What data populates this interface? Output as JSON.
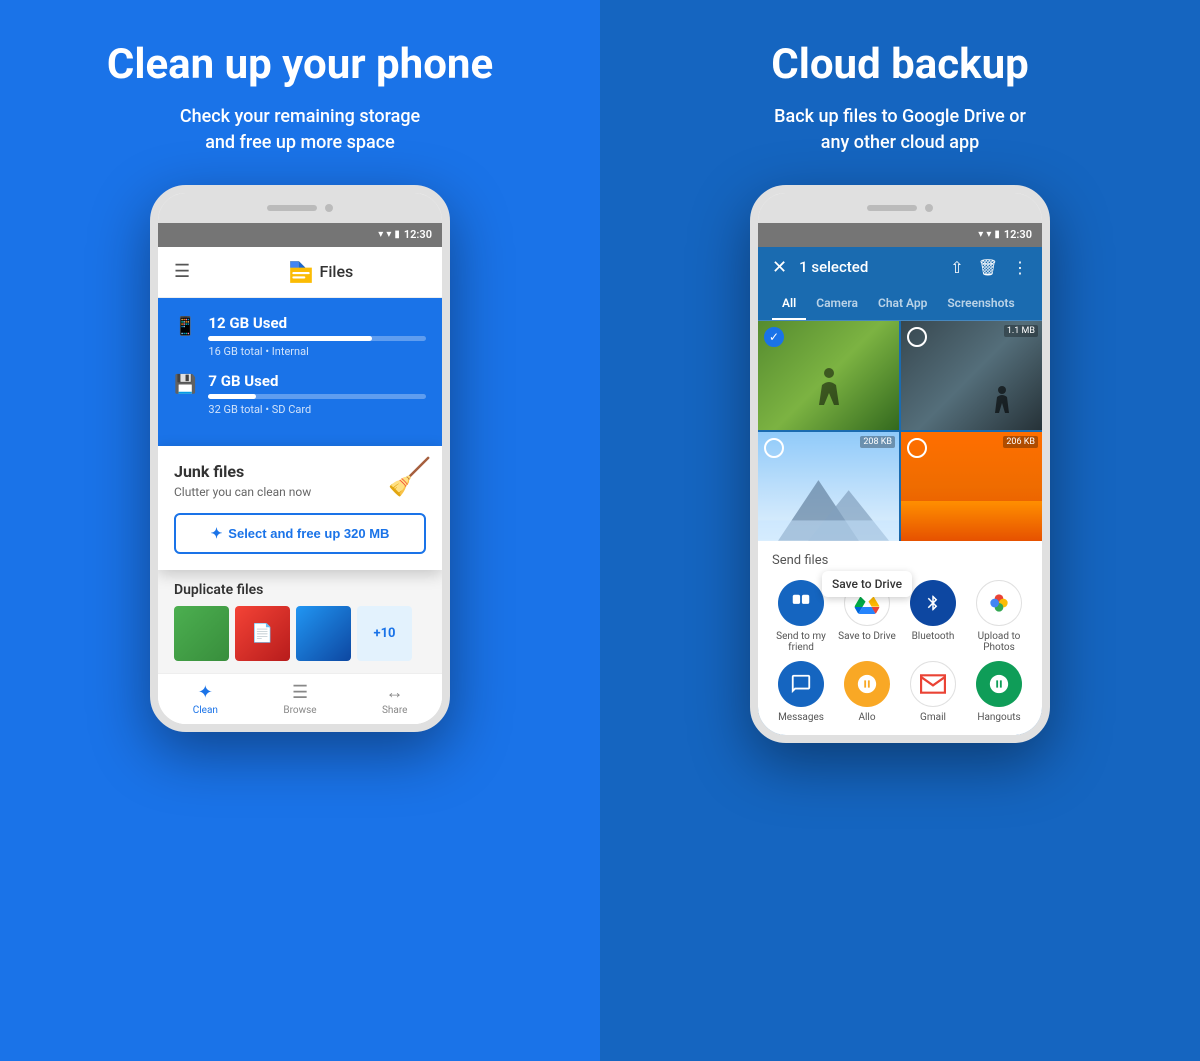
{
  "left_panel": {
    "title": "Clean up your phone",
    "subtitle": "Check your remaining storage\nand free up more space",
    "phone": {
      "status_time": "12:30",
      "app_name": "Files",
      "storage_items": [
        {
          "title": "12 GB Used",
          "detail": "16 GB total • Internal",
          "fill_percent": 75
        },
        {
          "title": "7 GB Used",
          "detail": "32 GB total • SD Card",
          "fill_percent": 22
        }
      ],
      "junk_card": {
        "title": "Junk files",
        "subtitle": "Clutter you can clean now",
        "button_label": "Select and free up 320 MB"
      },
      "duplicate_section": {
        "title": "Duplicate files"
      },
      "bottom_nav": [
        {
          "label": "Clean",
          "active": true
        },
        {
          "label": "Browse",
          "active": false
        },
        {
          "label": "Share",
          "active": false
        }
      ]
    }
  },
  "right_panel": {
    "title": "Cloud backup",
    "subtitle": "Back up files to Google Drive or\nany other cloud app",
    "phone": {
      "status_time": "12:30",
      "selection_bar": {
        "count_text": "1 selected"
      },
      "photo_tabs": [
        "All",
        "Camera",
        "Chat App",
        "Screenshots"
      ],
      "active_tab": "All",
      "photo_sizes": [
        "1.1 MB",
        "208 KB",
        "206 KB"
      ],
      "send_files_title": "Send files",
      "app_items": [
        {
          "label": "Send to my friend",
          "color": "#1565c0",
          "icon": "copy"
        },
        {
          "label": "Save to Drive",
          "color": "drive",
          "icon": "drive",
          "tooltip": "Save to Drive"
        },
        {
          "label": "Bluetooth",
          "color": "#0d47a1",
          "icon": "bluetooth"
        },
        {
          "label": "Upload to Photos",
          "color": "photos",
          "icon": "photos"
        },
        {
          "label": "Messages",
          "color": "#1565c0",
          "icon": "chat"
        },
        {
          "label": "Allo",
          "color": "#f9a825",
          "icon": "allo"
        },
        {
          "label": "Gmail",
          "color": "gmail",
          "icon": "gmail"
        },
        {
          "label": "Hangouts",
          "color": "#0f9d58",
          "icon": "hangouts"
        }
      ]
    }
  }
}
